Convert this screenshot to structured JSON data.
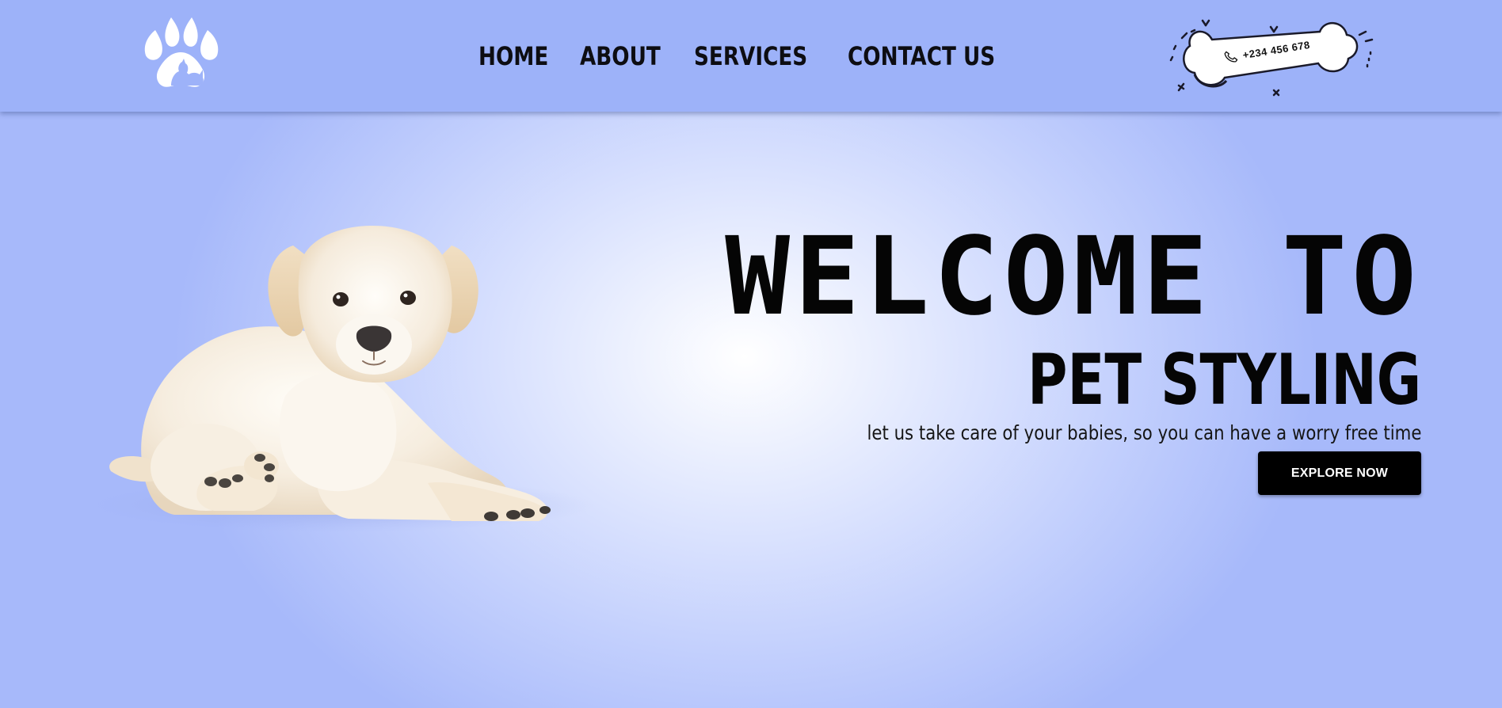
{
  "navbar": {
    "logo_icon": "paw-pets-logo-icon",
    "links": [
      {
        "label": "HOME"
      },
      {
        "label": "ABOUT"
      },
      {
        "label": "SERVICES"
      },
      {
        "label": "CONTACT US"
      }
    ],
    "phone": {
      "icon": "phone-icon",
      "number": "+234 456 678"
    }
  },
  "hero": {
    "image": "puppy-image",
    "title": "WELCOME TO",
    "subtitle": "PET STYLING",
    "tagline": "let us take care of your babies, so you can have a worry free time",
    "cta_label": "EXPLORE NOW"
  },
  "colors": {
    "navbar_bg": "#9db2f9",
    "background_center": "#ffffff",
    "background_edge": "#a7b9fa",
    "button_bg": "#000000",
    "text": "#050505"
  }
}
